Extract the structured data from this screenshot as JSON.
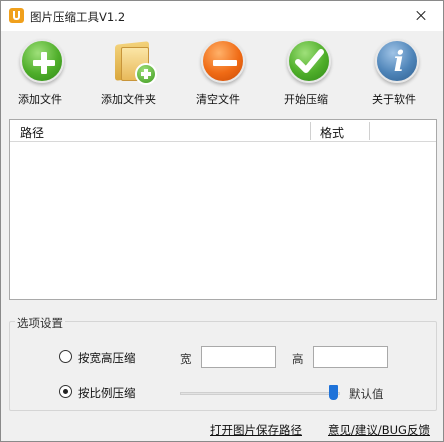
{
  "window": {
    "title": "图片压缩工具V1.2",
    "icon": "app-logo-icon"
  },
  "toolbar": {
    "buttons": [
      {
        "label": "添加文件",
        "icon": "add-green-circle-icon"
      },
      {
        "label": "添加文件夹",
        "icon": "folder-add-icon"
      },
      {
        "label": "清空文件",
        "icon": "minus-orange-circle-icon"
      },
      {
        "label": "开始压缩",
        "icon": "check-green-circle-icon"
      },
      {
        "label": "关于软件",
        "icon": "info-blue-circle-icon"
      }
    ]
  },
  "table": {
    "columns": [
      "路径",
      "格式"
    ],
    "rows": []
  },
  "options": {
    "group_title": "选项设置",
    "mode_wh": {
      "label": "按宽高压缩",
      "selected": false
    },
    "width_label": "宽",
    "width_value": "",
    "height_label": "高",
    "height_value": "",
    "mode_ratio": {
      "label": "按比例压缩",
      "selected": true
    },
    "slider_value_fraction": 0.95,
    "default_label": "默认值"
  },
  "footer": {
    "open_folder_link": "打开图片保存路径",
    "feedback_link": "意见/建议/BUG反馈"
  },
  "colors": {
    "accent": "#1e72d9",
    "window_bg": "#f0f0f0"
  }
}
